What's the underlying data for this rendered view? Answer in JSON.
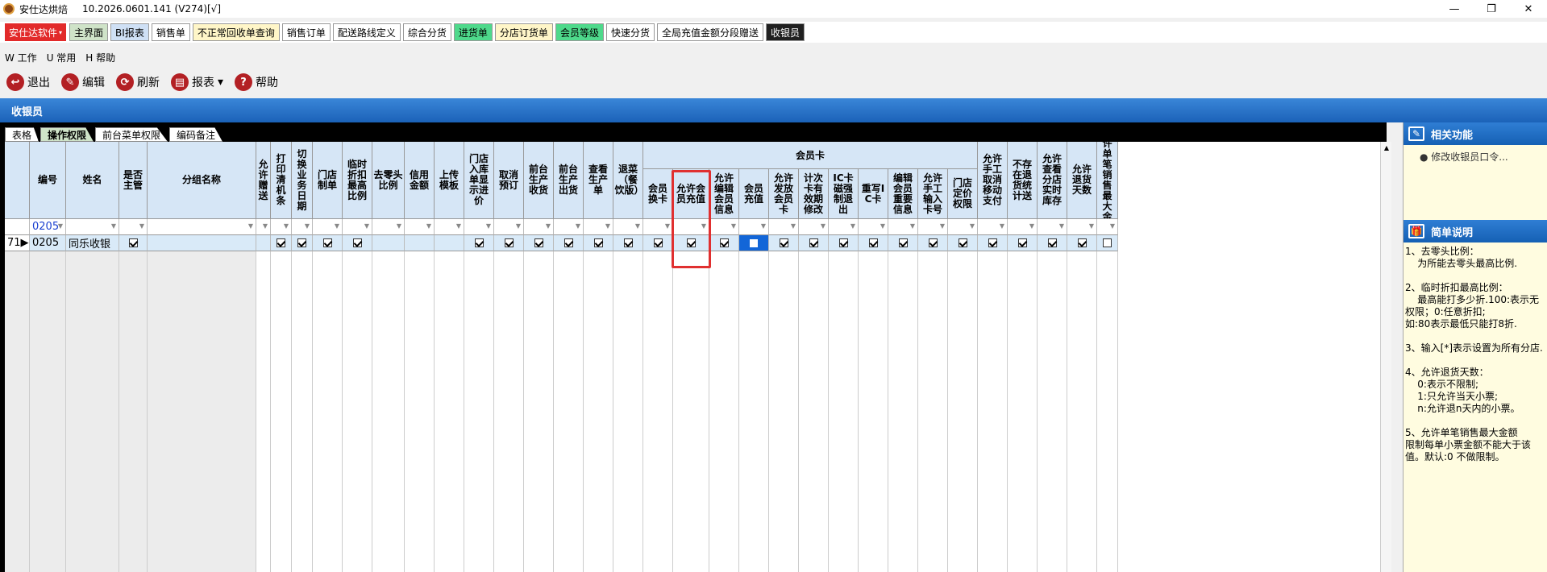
{
  "window": {
    "title": "安仕达烘焙",
    "version": "10.2026.0601.141 (V274)[√]",
    "minimize": "—",
    "restore": "❐",
    "close": "✕"
  },
  "brand": "安仕达软件",
  "nav_tabs": [
    {
      "label": "主界面",
      "bg": "#cfe3c8"
    },
    {
      "label": "BI报表",
      "bg": "#cfe0f5"
    },
    {
      "label": "销售单",
      "bg": "#ffffff"
    },
    {
      "label": "不正常回收单查询",
      "bg": "#fff6c8"
    },
    {
      "label": "销售订单",
      "bg": "#ffffff"
    },
    {
      "label": "配送路线定义",
      "bg": "#ffffff"
    },
    {
      "label": "综合分货",
      "bg": "#ffffff"
    },
    {
      "label": "进货单",
      "bg": "#4ed98b"
    },
    {
      "label": "分店订货单",
      "bg": "#fff6c8"
    },
    {
      "label": "会员等级",
      "bg": "#4ed98b"
    },
    {
      "label": "快速分货",
      "bg": "#ffffff"
    },
    {
      "label": "全局充值金额分段赠送",
      "bg": "#ffffff"
    },
    {
      "label": "收银员",
      "bg": "#202020",
      "fg": "#ffffff"
    }
  ],
  "menu": [
    "W 工作",
    "U 常用",
    "H 帮助"
  ],
  "toolbar": [
    {
      "label": "退出",
      "icon": "exit-icon",
      "glyph": "↩"
    },
    {
      "label": "编辑",
      "icon": "edit-icon",
      "glyph": "✎"
    },
    {
      "label": "刷新",
      "icon": "refresh-icon",
      "glyph": "⟳"
    },
    {
      "label": "报表",
      "icon": "print-icon",
      "glyph": "▤",
      "dropdown": "▾"
    },
    {
      "label": "帮助",
      "icon": "help-icon",
      "glyph": "?"
    }
  ],
  "form_title": "收银员",
  "sub_tabs": [
    "表格",
    "操作权限",
    "前台菜单权限",
    "编码备注"
  ],
  "grid": {
    "group_header": "会员卡",
    "columns": [
      "编号",
      "姓名",
      "是否主管",
      "分组名称",
      "允许赠送",
      "打印清机条",
      "切换业务日期",
      "门店制单",
      "临时折扣最高比例",
      "去零头比例",
      "信用金额",
      "上传模板",
      "门店入库单显示进价",
      "取消预订",
      "前台生产收货",
      "前台生产出货",
      "查看生产单",
      "退菜（餐饮版）",
      "会员换卡",
      "允许会员充值",
      "允许编辑会员信息",
      "会员充值",
      "允许发放会员卡",
      "计次卡有效期修改",
      "IC卡磁强制退出",
      "重写IC卡",
      "编辑会员重要信息",
      "允许手工输入卡号",
      "门店定价权限",
      "允许手工取消移动支付",
      "不存在退货统计送",
      "允许查看分店实时库存",
      "允许退货天数",
      "允许单笔销售最大金额"
    ],
    "filter_values": {
      "code": "0205"
    },
    "row": {
      "row_num": "71",
      "code": "0205",
      "name": "同乐收银",
      "checks": [
        true,
        null,
        null,
        true,
        true,
        true,
        true,
        null,
        null,
        null,
        true,
        true,
        true,
        true,
        true,
        true,
        true,
        true,
        true,
        "selected",
        true,
        true,
        true,
        true,
        true,
        true,
        true,
        true,
        true,
        true,
        true,
        false,
        null,
        null
      ]
    }
  },
  "right_panel": {
    "related_title": "相关功能",
    "related_items": [
      "修改收银员口令..."
    ],
    "note_title": "简单说明",
    "note_text": "1、去零头比例：\n    为所能去零头最高比例.\n\n2、临时折扣最高比例：\n    最高能打多少折.100:表示无权限；0:任意折扣;\n如:80表示最低只能打8折.\n\n3、输入[*]表示设置为所有分店.\n\n4、允许退货天数：\n    0:表示不限制;\n    1:只允许当天小票;\n    n:允许退n天内的小票。\n\n5、允许单笔销售最大金额\n限制每单小票金额不能大于该值。默认:0 不做限制。"
  }
}
